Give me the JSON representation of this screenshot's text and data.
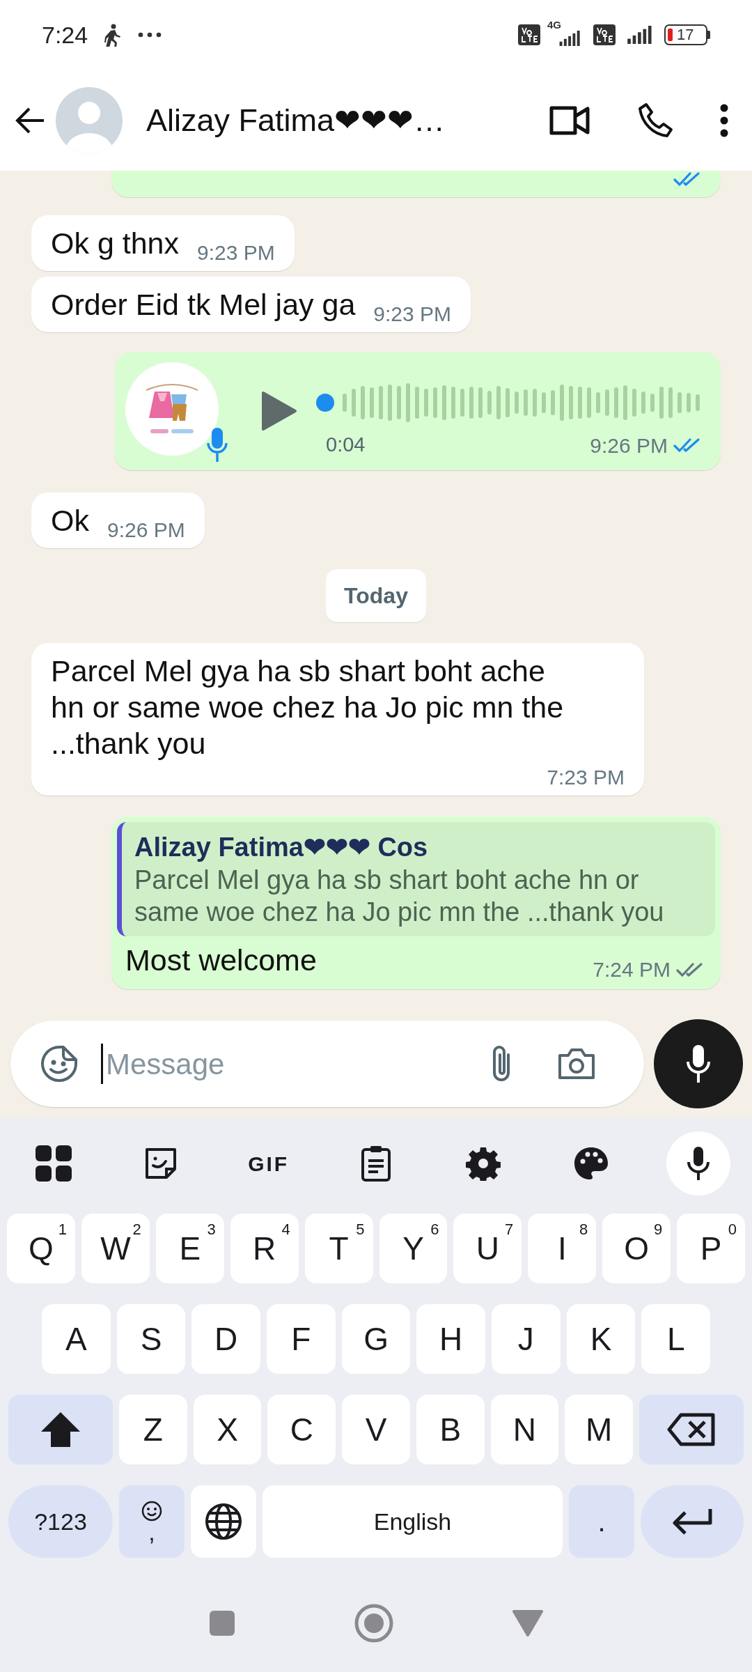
{
  "status_bar": {
    "time": "7:24",
    "network": "4G",
    "battery": "17"
  },
  "header": {
    "title": "Alizay Fatima❤❤❤…"
  },
  "messages": [
    {
      "kind": "clipped",
      "outgoing": true,
      "read": true
    },
    {
      "kind": "text",
      "outgoing": false,
      "text": "Ok g thnx",
      "time": "9:23 PM"
    },
    {
      "kind": "text",
      "outgoing": false,
      "text": "Order Eid tk Mel jay ga",
      "time": "9:23 PM"
    },
    {
      "kind": "voice",
      "outgoing": true,
      "duration": "0:04",
      "time": "9:26 PM",
      "read": true
    },
    {
      "kind": "text",
      "outgoing": false,
      "text": "Ok",
      "time": "9:26 PM"
    },
    {
      "kind": "date",
      "text": "Today"
    },
    {
      "kind": "text",
      "outgoing": false,
      "text": "Parcel Mel gya ha sb shart boht ache hn or same woe chez ha Jo pic mn the ...thank you",
      "time": "7:23 PM"
    },
    {
      "kind": "reply",
      "outgoing": true,
      "quote_author": "Alizay Fatima❤❤❤ Cos",
      "quote_text": "Parcel Mel gya ha sb shart boht ache hn or same woe chez ha Jo pic mn the ...thank you",
      "text": "Most welcome",
      "time": "7:24 PM",
      "read": false
    }
  ],
  "composer": {
    "placeholder": "Message"
  },
  "keyboard": {
    "gif_label": "GIF",
    "rows": [
      [
        {
          "kind": "letter",
          "label": "Q",
          "hint": "1"
        },
        {
          "kind": "letter",
          "label": "W",
          "hint": "2"
        },
        {
          "kind": "letter",
          "label": "E",
          "hint": "3"
        },
        {
          "kind": "letter",
          "label": "R",
          "hint": "4"
        },
        {
          "kind": "letter",
          "label": "T",
          "hint": "5"
        },
        {
          "kind": "letter",
          "label": "Y",
          "hint": "6"
        },
        {
          "kind": "letter",
          "label": "U",
          "hint": "7"
        },
        {
          "kind": "letter",
          "label": "I",
          "hint": "8"
        },
        {
          "kind": "letter",
          "label": "O",
          "hint": "9"
        },
        {
          "kind": "letter",
          "label": "P",
          "hint": "0"
        }
      ],
      [
        {
          "kind": "letter",
          "label": "A"
        },
        {
          "kind": "letter",
          "label": "S"
        },
        {
          "kind": "letter",
          "label": "D"
        },
        {
          "kind": "letter",
          "label": "F"
        },
        {
          "kind": "letter",
          "label": "G"
        },
        {
          "kind": "letter",
          "label": "H"
        },
        {
          "kind": "letter",
          "label": "J"
        },
        {
          "kind": "letter",
          "label": "K"
        },
        {
          "kind": "letter",
          "label": "L"
        }
      ],
      [
        {
          "kind": "shift"
        },
        {
          "kind": "letter",
          "label": "Z"
        },
        {
          "kind": "letter",
          "label": "X"
        },
        {
          "kind": "letter",
          "label": "C"
        },
        {
          "kind": "letter",
          "label": "V"
        },
        {
          "kind": "letter",
          "label": "B"
        },
        {
          "kind": "letter",
          "label": "N"
        },
        {
          "kind": "letter",
          "label": "M"
        },
        {
          "kind": "backspace"
        }
      ]
    ],
    "bottom_row": [
      {
        "kind": "symbols",
        "label": "?123"
      },
      {
        "kind": "emoji",
        "label": ","
      },
      {
        "kind": "globe"
      },
      {
        "kind": "space",
        "label": "English"
      },
      {
        "kind": "period",
        "label": "."
      },
      {
        "kind": "enter"
      }
    ]
  }
}
